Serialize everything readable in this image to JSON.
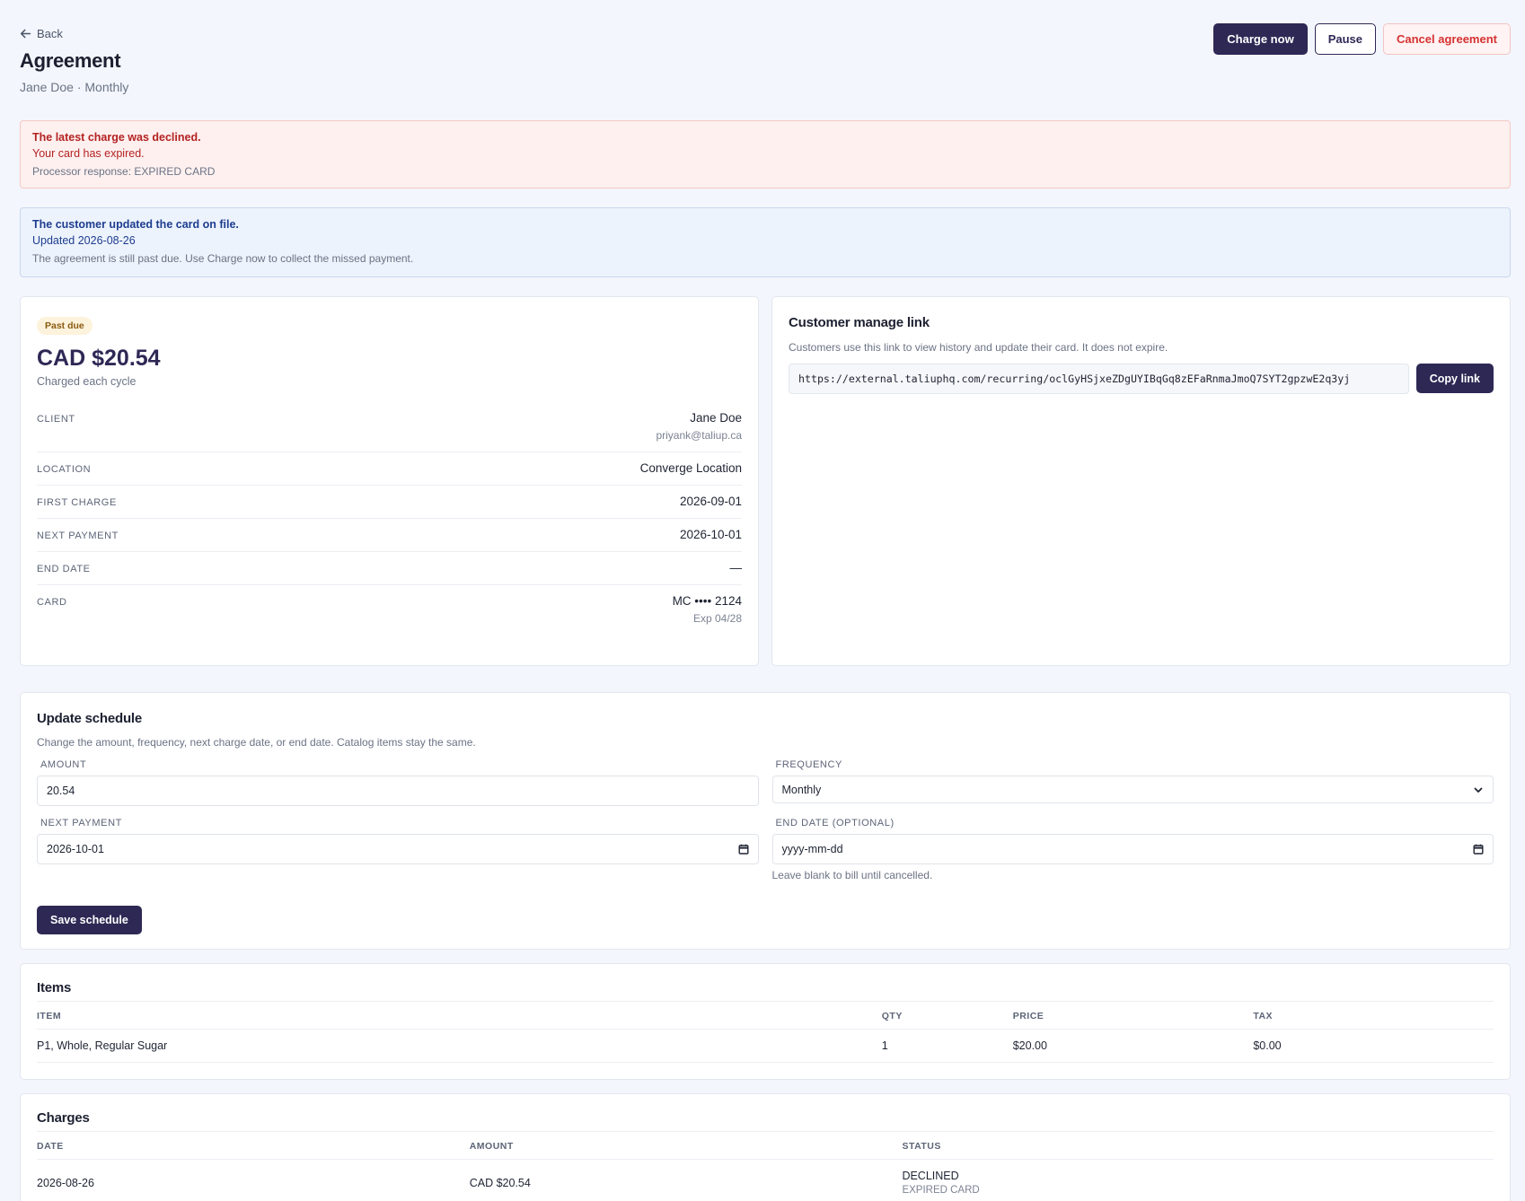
{
  "header": {
    "back_label": "Back",
    "title": "Agreement",
    "subtitle": "Jane Doe · Monthly",
    "actions": {
      "charge_now": "Charge now",
      "pause": "Pause",
      "cancel": "Cancel agreement"
    }
  },
  "alerts": {
    "declined": {
      "title": "The latest charge was declined.",
      "message": "Your card has expired.",
      "detail": "Processor response: EXPIRED CARD"
    },
    "card_updated": {
      "title": "The customer updated the card on file.",
      "message": "Updated 2026-08-26",
      "detail": "The agreement is still past due. Use Charge now to collect the missed payment."
    }
  },
  "summary": {
    "status_badge": "Past due",
    "amount": "CAD $20.54",
    "amount_caption": "Charged each cycle",
    "rows": {
      "client": {
        "label": "CLIENT",
        "value": "Jane Doe",
        "sub": "priyank@taliup.ca"
      },
      "location": {
        "label": "LOCATION",
        "value": "Converge Location"
      },
      "first_charge": {
        "label": "FIRST CHARGE",
        "value": "2026-09-01"
      },
      "next_payment": {
        "label": "NEXT PAYMENT",
        "value": "2026-10-01"
      },
      "end_date": {
        "label": "END DATE",
        "value": "—"
      },
      "card": {
        "label": "CARD",
        "value": "MC •••• 2124",
        "sub": "Exp 04/28"
      }
    }
  },
  "manage_link": {
    "title": "Customer manage link",
    "description": "Customers use this link to view history and update their card. It does not expire.",
    "url": "https://external.taliuphq.com/recurring/oclGyHSjxeZDgUYIBqGq8zEFaRnmaJmoQ7SYT2gpzwE2q3yj",
    "copy_label": "Copy link"
  },
  "schedule": {
    "title": "Update schedule",
    "description": "Change the amount, frequency, next charge date, or end date. Catalog items stay the same.",
    "amount": {
      "label": "AMOUNT",
      "value": "20.54"
    },
    "frequency": {
      "label": "FREQUENCY",
      "value": "Monthly"
    },
    "next_payment": {
      "label": "NEXT PAYMENT",
      "value": "2026-10-01"
    },
    "end_date": {
      "label": "END DATE (OPTIONAL)",
      "placeholder": "yyyy-mm-dd",
      "hint": "Leave blank to bill until cancelled."
    },
    "save_label": "Save schedule"
  },
  "items": {
    "title": "Items",
    "columns": {
      "item": "ITEM",
      "qty": "QTY",
      "price": "PRICE",
      "tax": "TAX"
    },
    "rows": [
      {
        "item": "P1, Whole, Regular Sugar",
        "qty": "1",
        "price": "$20.00",
        "tax": "$0.00"
      }
    ]
  },
  "charges": {
    "title": "Charges",
    "columns": {
      "date": "DATE",
      "amount": "AMOUNT",
      "status": "STATUS"
    },
    "rows": [
      {
        "date": "2026-08-26",
        "amount": "CAD $20.54",
        "status": "DECLINED",
        "status_detail": "EXPIRED CARD"
      }
    ]
  },
  "colors": {
    "brand": "#2e2855",
    "danger": "#d53131",
    "danger_bg": "#fdf0ef",
    "info_bg": "#edf3fc",
    "warning_bg": "#fdf3dc",
    "page_bg": "#f3f6fc"
  },
  "icons": {
    "back": "arrow-left-icon",
    "calendar": "calendar-icon",
    "select": "chevron-down-icon"
  }
}
